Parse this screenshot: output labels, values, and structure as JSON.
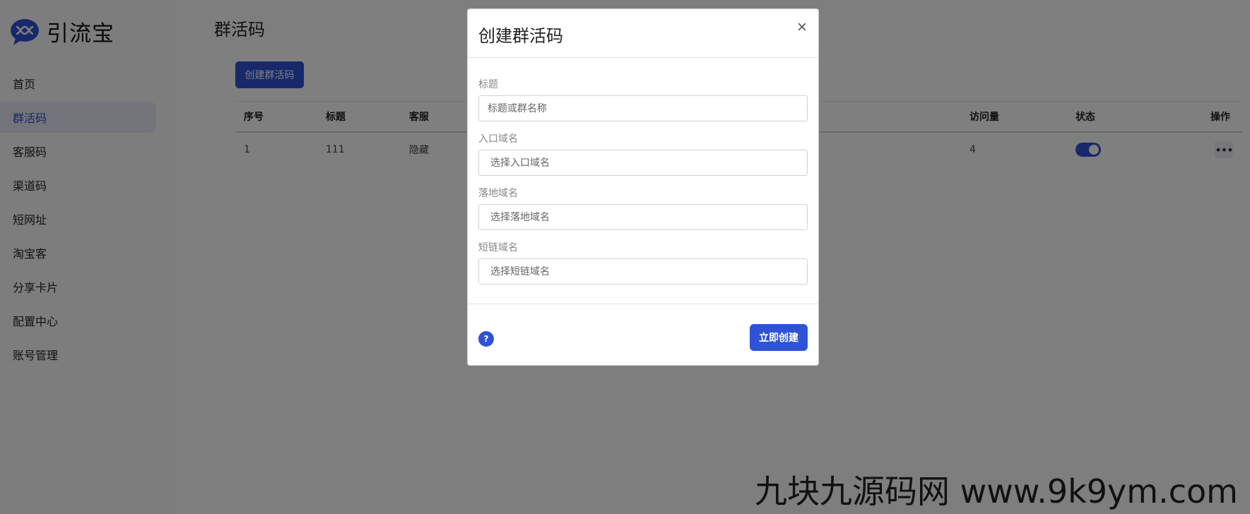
{
  "brand": {
    "name": "引流宝",
    "icon": "chat-bubble-logo-icon",
    "accent": "#2f53d6"
  },
  "sidebar": {
    "items": [
      {
        "label": "首页",
        "active": false
      },
      {
        "label": "群活码",
        "active": true
      },
      {
        "label": "客服码",
        "active": false
      },
      {
        "label": "渠道码",
        "active": false
      },
      {
        "label": "短网址",
        "active": false
      },
      {
        "label": "淘宝客",
        "active": false
      },
      {
        "label": "分享卡片",
        "active": false
      },
      {
        "label": "配置中心",
        "active": false
      },
      {
        "label": "账号管理",
        "active": false
      }
    ]
  },
  "main": {
    "title": "群活码",
    "create_button": "创建群活码",
    "table": {
      "headers": {
        "index": "序号",
        "title": "标题",
        "service": "客服",
        "visits": "访问量",
        "status": "状态",
        "actions": "操作"
      },
      "rows": [
        {
          "index": "1",
          "title": "111",
          "service": "隐藏",
          "visits": "4",
          "status_on": true,
          "more": "•••"
        }
      ]
    }
  },
  "modal": {
    "title": "创建群活码",
    "close_symbol": "×",
    "fields": [
      {
        "label": "标题",
        "placeholder": "标题或群名称"
      },
      {
        "label": "入口域名",
        "placeholder": "选择入口域名"
      },
      {
        "label": "落地域名",
        "placeholder": "选择落地域名"
      },
      {
        "label": "短链域名",
        "placeholder": "选择短链域名"
      }
    ],
    "help_symbol": "?",
    "submit_label": "立即创建"
  },
  "watermark": "九块九源码网 www.9k9ym.com"
}
